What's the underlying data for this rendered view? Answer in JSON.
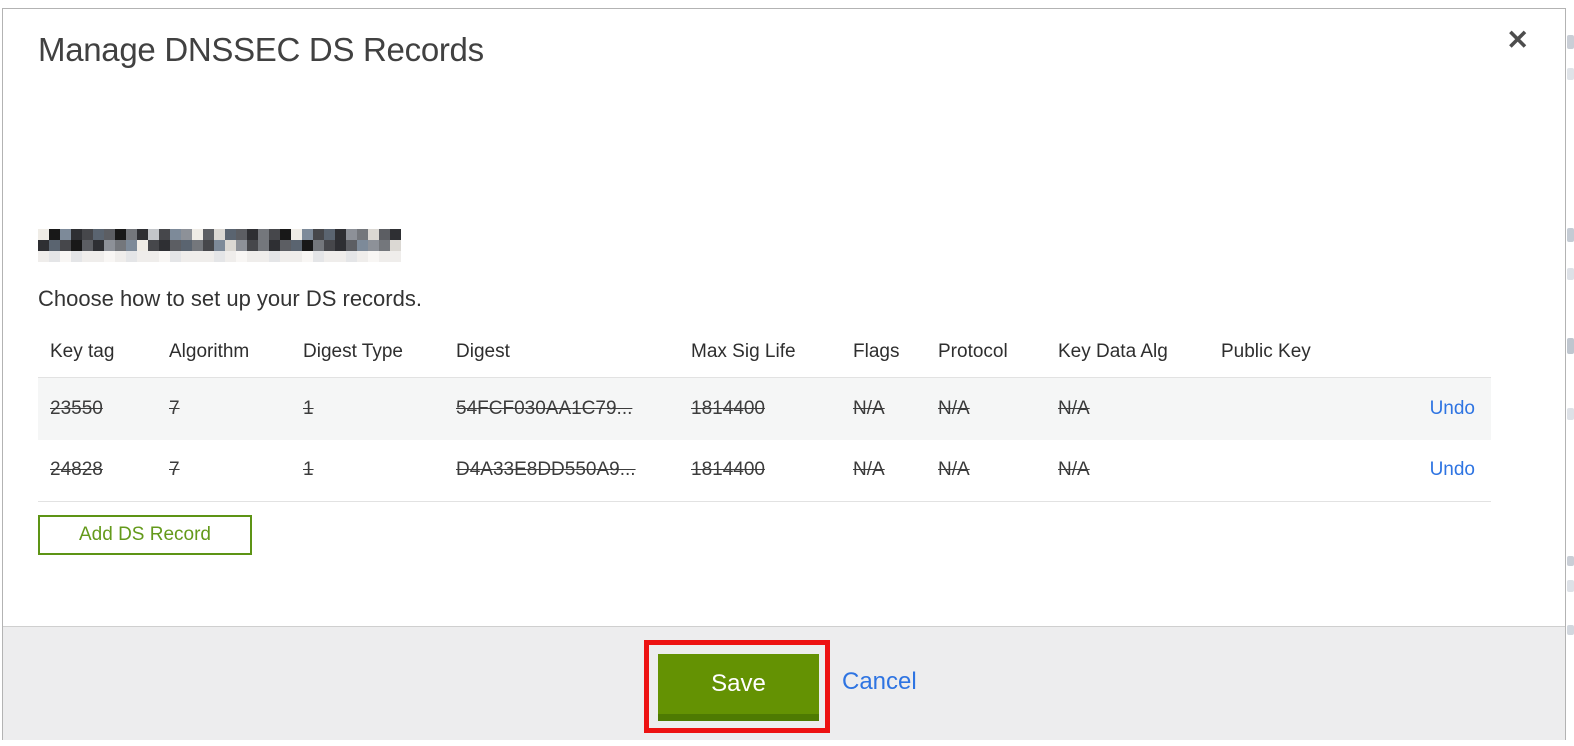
{
  "modal": {
    "title": "Manage DNSSEC DS Records",
    "close_glyph": "✕",
    "subtitle": "Choose how to set up your DS records.",
    "domain_redacted": {
      "note": "pixelated-censored-domain-name",
      "palette": [
        "#181818",
        "#2e2f33",
        "#46474b",
        "#5c5e63",
        "#74777c",
        "#8d9198",
        "#a8adb4",
        "#c3c6ca",
        "#dbd8d3",
        "#efece6",
        "#5a6470",
        "#7d8a99"
      ],
      "rows": [
        "90b12a304172b5938a314209b2a154831",
        "1a203154b9213a42b852413a04213b548",
        "879788987889788878988788978878988"
      ]
    },
    "table": {
      "columns": [
        "Key tag",
        "Algorithm",
        "Digest Type",
        "Digest",
        "Max Sig Life",
        "Flags",
        "Protocol",
        "Key Data Alg",
        "Public Key"
      ],
      "column_keys": [
        "key-tag",
        "algorithm",
        "digest-type",
        "digest",
        "max-sig-life",
        "flags",
        "protocol",
        "key-data-alg",
        "public-key"
      ],
      "rows": [
        {
          "cells": [
            "23550",
            "7",
            "1",
            "54FCF030AA1C79...",
            "1814400",
            "N/A",
            "N/A",
            "N/A",
            ""
          ],
          "action": "Undo",
          "deleted": true
        },
        {
          "cells": [
            "24828",
            "7",
            "1",
            "D4A33E8DD550A9...",
            "1814400",
            "N/A",
            "N/A",
            "N/A",
            ""
          ],
          "action": "Undo",
          "deleted": true
        }
      ]
    },
    "add_button_label": "Add DS Record",
    "footer": {
      "save_label": "Save",
      "cancel_label": "Cancel"
    },
    "colors": {
      "save_green": "#649203",
      "save_green_dark": "#4e7a02",
      "add_button_green": "#5d9415",
      "link_blue": "#2e74e2",
      "annotation_red": "#ed1212",
      "footer_gray": "#ededee",
      "row_alt_gray": "#f5f6f6"
    }
  }
}
